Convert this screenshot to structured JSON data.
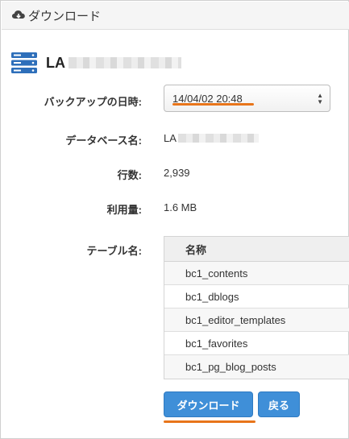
{
  "header": {
    "title": "ダウンロード",
    "icon": "cloud-download-icon"
  },
  "database": {
    "icon": "database-server-icon",
    "name_visible": "LA"
  },
  "form": {
    "backup_label": "バックアップの日時:",
    "backup_value": "14/04/02 20:48",
    "dbname_label": "データベース名:",
    "dbname_value_visible": "LA",
    "rows_label": "行数:",
    "rows_value": "2,939",
    "usage_label": "利用量:",
    "usage_value": "1.6 MB",
    "tables_label": "テーブル名:"
  },
  "table": {
    "header": "名称",
    "rows": [
      "bc1_contents",
      "bc1_dblogs",
      "bc1_editor_templates",
      "bc1_favorites",
      "bc1_pg_blog_posts"
    ]
  },
  "buttons": {
    "download": "ダウンロード",
    "back": "戻る"
  },
  "colors": {
    "accent_underline": "#e8751a",
    "button": "#3f8fd8",
    "icon_blue": "#2e6fba"
  }
}
